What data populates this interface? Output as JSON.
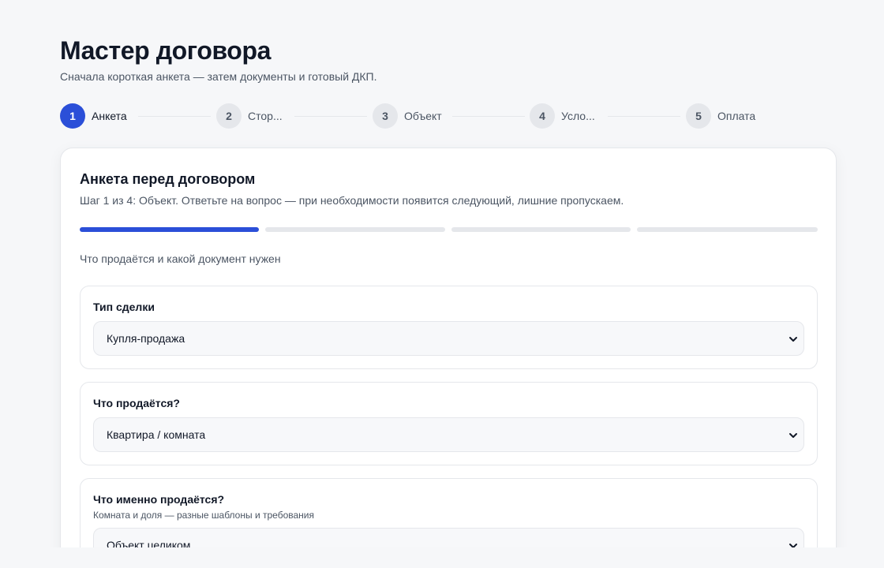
{
  "header": {
    "title": "Мастер договора",
    "subtitle": "Сначала короткая анкета — затем документы и готовый ДКП."
  },
  "stepper": {
    "active_index": 0,
    "steps": [
      {
        "number": "1",
        "label": "Анкета"
      },
      {
        "number": "2",
        "label": "Стор..."
      },
      {
        "number": "3",
        "label": "Объект"
      },
      {
        "number": "4",
        "label": "Усло..."
      },
      {
        "number": "5",
        "label": "Оплата"
      }
    ]
  },
  "card": {
    "title": "Анкета перед договором",
    "subtitle": "Шаг 1 из 4: Объект. Ответьте на вопрос — при необходимости появится следующий, лишние пропускаем.",
    "progress": {
      "current": 1,
      "total": 4
    },
    "section_title": "Что продаётся и какой документ нужен",
    "fields": [
      {
        "label": "Тип сделки",
        "hint": "",
        "value": "Купля-продажа"
      },
      {
        "label": "Что продаётся?",
        "hint": "",
        "value": "Квартира / комната"
      },
      {
        "label": "Что именно продаётся?",
        "hint": "Комната и доля — разные шаблоны и требования",
        "value": "Объект целиком"
      }
    ]
  },
  "colors": {
    "accent": "#2b4fd8",
    "muted_track": "#e5e7eb",
    "background": "#f6f7f9"
  },
  "icons": {
    "select_chevron": "chevron-down-icon"
  }
}
